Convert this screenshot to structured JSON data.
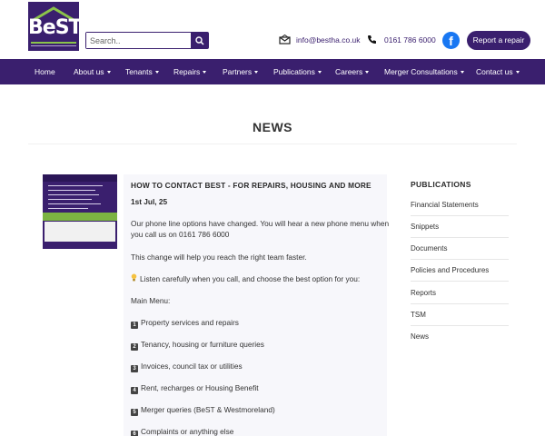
{
  "header": {
    "logo_text": "BeST",
    "search_placeholder": "Search..",
    "email": "info@bestha.co.uk",
    "phone": "0161 786 6000",
    "facebook_label": "f",
    "repair_button": "Report a repair",
    "colors": {
      "brand_purple": "#3a1f6e",
      "facebook_blue": "#1877f2",
      "accent_green": "#7cb342"
    }
  },
  "nav": {
    "items": [
      {
        "label": "Home",
        "dropdown": false
      },
      {
        "label": "About us",
        "dropdown": true
      },
      {
        "label": "Tenants",
        "dropdown": true
      },
      {
        "label": "Repairs",
        "dropdown": true
      },
      {
        "label": "Partners",
        "dropdown": true
      },
      {
        "label": "Publications",
        "dropdown": true
      },
      {
        "label": "Careers",
        "dropdown": true
      },
      {
        "label": "Merger Consultations",
        "dropdown": true
      },
      {
        "label": "Contact us",
        "dropdown": true
      }
    ]
  },
  "page": {
    "title": "NEWS"
  },
  "article": {
    "title": "HOW TO CONTACT BEST - FOR REPAIRS, HOUSING AND MORE",
    "date": "1st Jul, 25",
    "para1_line1": "Our phone line options have changed. You will hear a new phone menu when",
    "para1_line2": "you call us on 0161 786 6000",
    "para2": "This change will help you reach the right team faster.",
    "para3": "Listen carefully when you call, and choose the best option for you:",
    "menu_heading": "Main Menu:",
    "menu_options": [
      {
        "key": "1",
        "label": "Property services and repairs"
      },
      {
        "key": "2",
        "label": "Tenancy, housing or furniture queries"
      },
      {
        "key": "3",
        "label": "Invoices, council tax or utilities"
      },
      {
        "key": "4",
        "label": "Rent, recharges or Housing Benefit"
      },
      {
        "key": "5",
        "label": "Merger queries (BeST & Westmoreland)"
      },
      {
        "key": "6",
        "label": "Complaints or anything else"
      }
    ],
    "icons": {
      "thumbnail": "phone-options-image",
      "bullet": "lightbulb-icon",
      "keys": "number-key-icon"
    }
  },
  "sidebar": {
    "heading": "PUBLICATIONS",
    "items": [
      "Financial Statements",
      "Snippets",
      "Documents",
      "Policies and Procedures",
      "Reports",
      "TSM",
      "News"
    ]
  }
}
